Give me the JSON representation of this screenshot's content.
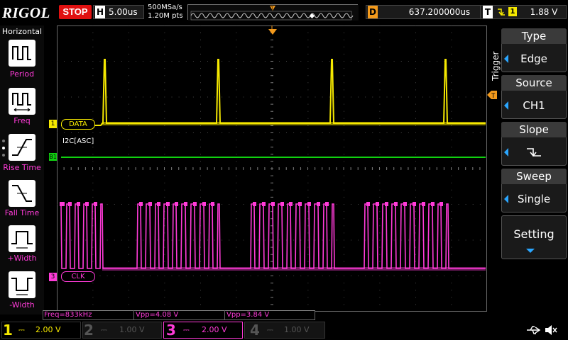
{
  "topbar": {
    "brand": "RIGOL",
    "run_state": "STOP",
    "horizontal_label": "H",
    "timebase": "5.00us",
    "sample_rate": "500MSa/s",
    "memory_points": "1.20M pts",
    "delay_label": "D",
    "delay_value": "637.200000us",
    "trigger_label": "T",
    "trigger_source": "1",
    "trigger_level": "1.88 V"
  },
  "left_menu": {
    "title": "Horizontal",
    "items": [
      {
        "label": "Period",
        "icon": "period-icon"
      },
      {
        "label": "Freq",
        "icon": "frequency-icon"
      },
      {
        "label": "Rise Time",
        "icon": "rise-time-icon"
      },
      {
        "label": "Fall Time",
        "icon": "fall-time-icon"
      },
      {
        "label": "+Width",
        "icon": "positive-width-icon"
      },
      {
        "label": "-Width",
        "icon": "negative-width-icon"
      }
    ]
  },
  "scope": {
    "data_label": "DATA",
    "clk_label": "CLK",
    "bus_label": "I2C[ASC]",
    "ch1_marker": "1",
    "ch3_marker": "3",
    "bus_marker": "B1",
    "trigger_marker": "T",
    "colors": {
      "ch1": "#f5e800",
      "ch3": "#ff3bd8",
      "bus": "#10d010",
      "trigger": "#f39a1c"
    }
  },
  "measurements": [
    "Freq=833kHz",
    "Vpp=4.08 V",
    "Vpp=3.84 V"
  ],
  "right_menu": {
    "title": "Trigger",
    "items": [
      {
        "header": "Type",
        "value": "Edge"
      },
      {
        "header": "Source",
        "value": "CH1"
      },
      {
        "header": "Slope",
        "value": "falling-edge-icon"
      },
      {
        "header": "Sweep",
        "value": "Single"
      },
      {
        "header": "Setting",
        "value": ""
      }
    ]
  },
  "bottom_bar": {
    "channels": [
      {
        "num": "1",
        "scale": "2.00 V",
        "active": true,
        "color": "#f5e800"
      },
      {
        "num": "2",
        "scale": "1.00 V",
        "active": false,
        "color": "#2aa6ff"
      },
      {
        "num": "3",
        "scale": "2.00 V",
        "active": true,
        "color": "#ff3bd8"
      },
      {
        "num": "4",
        "scale": "1.00 V",
        "active": false,
        "color": "#2aa6ff"
      }
    ]
  }
}
